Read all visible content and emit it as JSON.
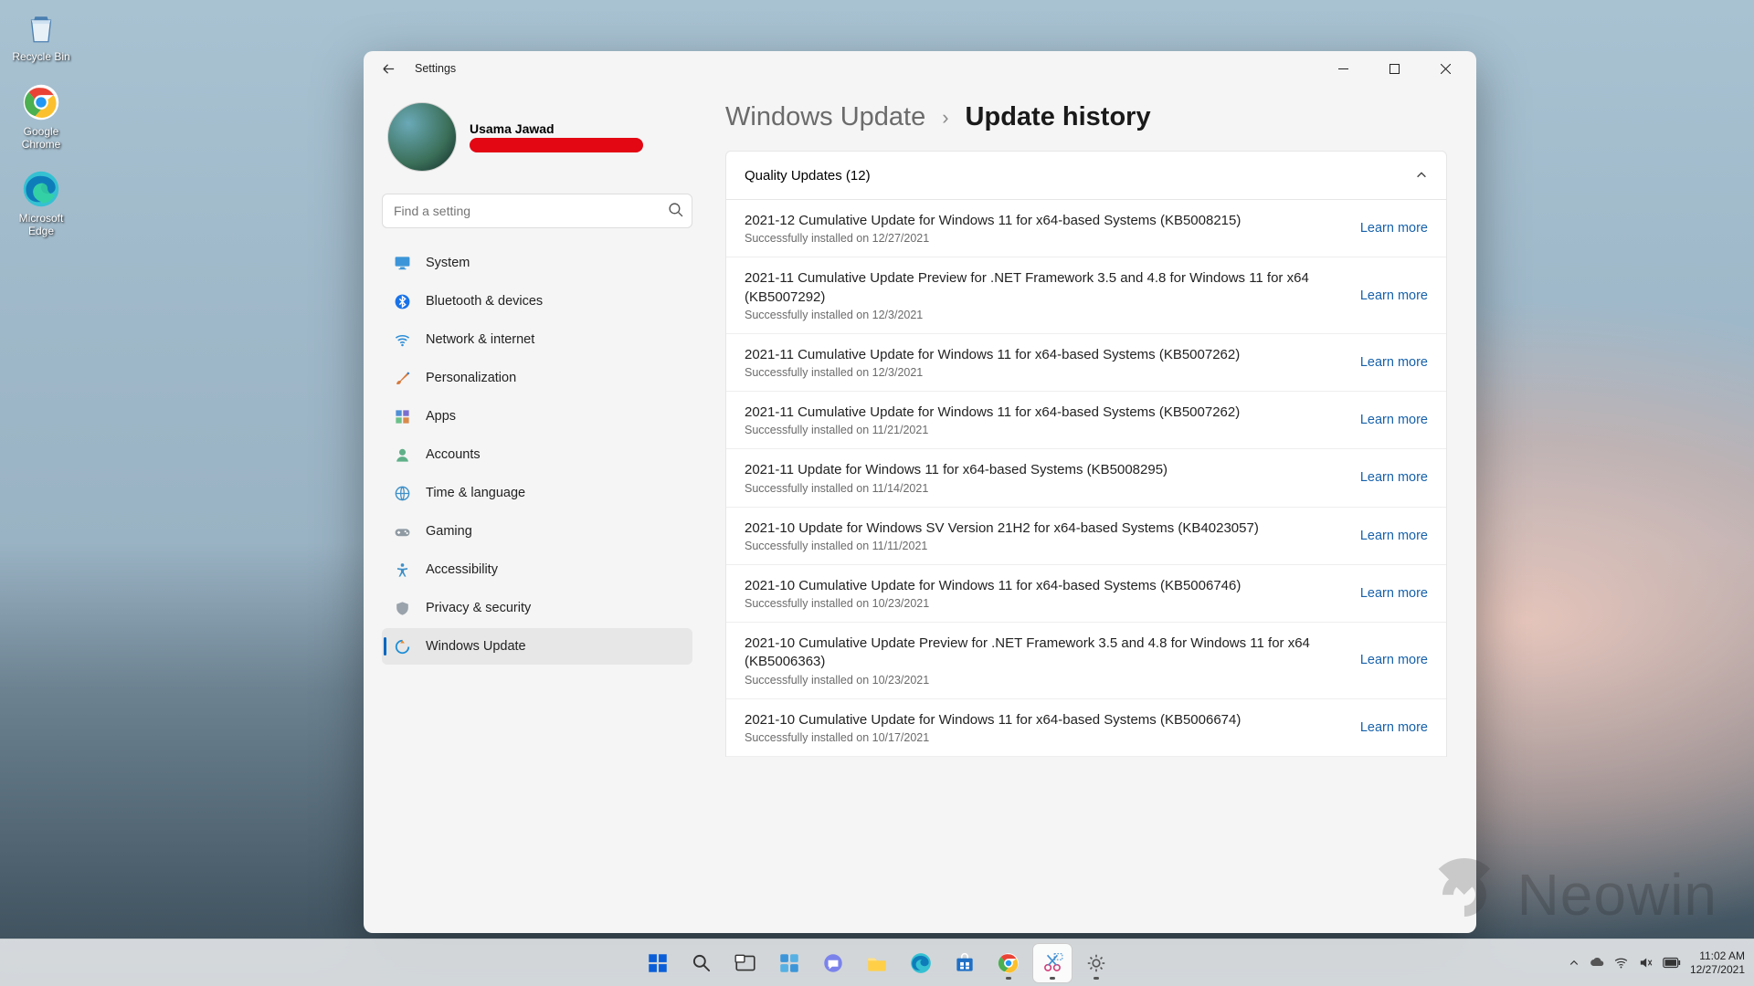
{
  "desktop": {
    "icons": [
      {
        "name": "Recycle Bin"
      },
      {
        "name": "Google Chrome"
      },
      {
        "name": "Microsoft Edge"
      }
    ]
  },
  "window": {
    "appTitle": "Settings",
    "user": {
      "displayName": "Usama Jawad"
    },
    "search": {
      "placeholder": "Find a setting"
    },
    "nav": [
      {
        "label": "System",
        "icon": "monitor",
        "selected": false
      },
      {
        "label": "Bluetooth & devices",
        "icon": "bluetooth",
        "selected": false
      },
      {
        "label": "Network & internet",
        "icon": "wifi",
        "selected": false
      },
      {
        "label": "Personalization",
        "icon": "brush",
        "selected": false
      },
      {
        "label": "Apps",
        "icon": "grid",
        "selected": false
      },
      {
        "label": "Accounts",
        "icon": "person",
        "selected": false
      },
      {
        "label": "Time & language",
        "icon": "globe",
        "selected": false
      },
      {
        "label": "Gaming",
        "icon": "gamepad",
        "selected": false
      },
      {
        "label": "Accessibility",
        "icon": "accessibility",
        "selected": false
      },
      {
        "label": "Privacy & security",
        "icon": "shield",
        "selected": false
      },
      {
        "label": "Windows Update",
        "icon": "update",
        "selected": true
      }
    ],
    "breadcrumb": {
      "parent": "Windows Update",
      "current": "Update history"
    },
    "section": {
      "title": "Quality Updates (12)",
      "learnMoreLabel": "Learn more",
      "items": [
        {
          "title": "2021-12 Cumulative Update for Windows 11 for x64-based Systems (KB5008215)",
          "status": "Successfully installed on 12/27/2021"
        },
        {
          "title": "2021-11 Cumulative Update Preview for .NET Framework 3.5 and 4.8 for Windows 11 for x64 (KB5007292)",
          "status": "Successfully installed on 12/3/2021"
        },
        {
          "title": "2021-11 Cumulative Update for Windows 11 for x64-based Systems (KB5007262)",
          "status": "Successfully installed on 12/3/2021"
        },
        {
          "title": "2021-11 Cumulative Update for Windows 11 for x64-based Systems (KB5007262)",
          "status": "Successfully installed on 11/21/2021"
        },
        {
          "title": "2021-11 Update for Windows 11 for x64-based Systems (KB5008295)",
          "status": "Successfully installed on 11/14/2021"
        },
        {
          "title": "2021-10 Update for Windows SV Version 21H2 for x64-based Systems (KB4023057)",
          "status": "Successfully installed on 11/11/2021"
        },
        {
          "title": "2021-10 Cumulative Update for Windows 11 for x64-based Systems (KB5006746)",
          "status": "Successfully installed on 10/23/2021"
        },
        {
          "title": "2021-10 Cumulative Update Preview for .NET Framework 3.5 and 4.8 for Windows 11 for x64 (KB5006363)",
          "status": "Successfully installed on 10/23/2021"
        },
        {
          "title": "2021-10 Cumulative Update for Windows 11 for x64-based Systems (KB5006674)",
          "status": "Successfully installed on 10/17/2021"
        }
      ]
    }
  },
  "taskbar": {
    "items": [
      {
        "name": "start",
        "active": false
      },
      {
        "name": "search",
        "active": false
      },
      {
        "name": "task-view",
        "active": false
      },
      {
        "name": "widgets",
        "active": false
      },
      {
        "name": "chat",
        "active": false
      },
      {
        "name": "file-explorer",
        "active": false
      },
      {
        "name": "edge",
        "active": false
      },
      {
        "name": "store",
        "active": false
      },
      {
        "name": "chrome",
        "active": true
      },
      {
        "name": "snipping-tool",
        "active": true,
        "selected": true
      },
      {
        "name": "settings",
        "active": true
      }
    ],
    "clock": {
      "time": "11:02 AM",
      "date": "12/27/2021"
    }
  },
  "watermark": "Neowin"
}
